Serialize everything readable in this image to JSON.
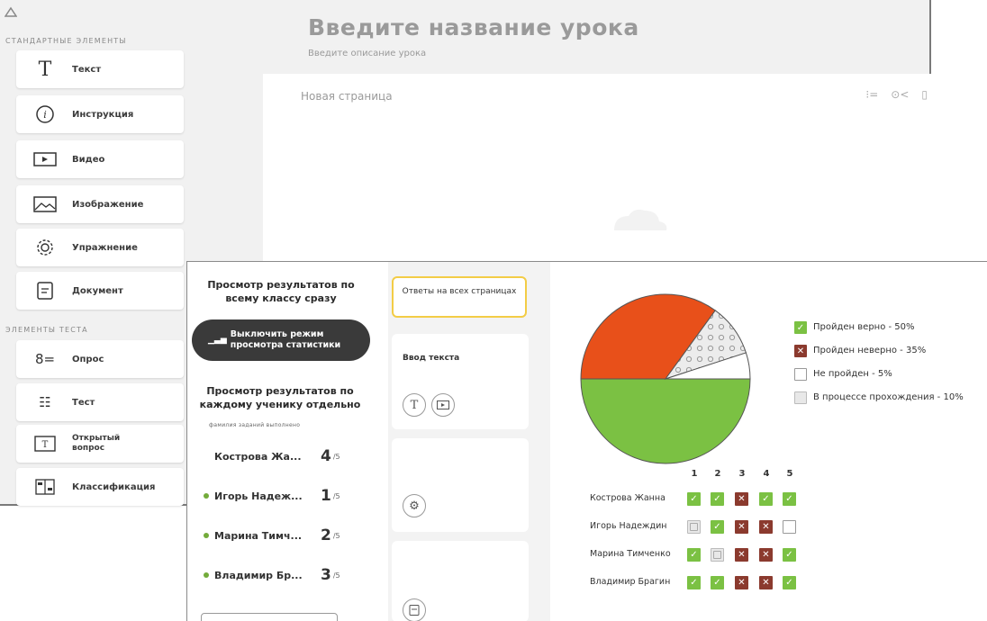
{
  "editor": {
    "sections": {
      "standard": "СТАНДАРТНЫЕ ЭЛЕМЕНТЫ",
      "test": "ЭЛЕМЕНТЫ ТЕСТА"
    },
    "standard_tools": [
      "Текст",
      "Инструкция",
      "Видео",
      "Изображение",
      "Упражнение",
      "Документ"
    ],
    "test_tools": [
      "Опрос",
      "Тест",
      "Открытый вопрос",
      "Классификация"
    ],
    "lesson_title": "Введите название урока",
    "lesson_description": "Введите описание урока",
    "page_name": "Новая страница"
  },
  "stats": {
    "class_view_heading": "Просмотр результатов по всему классу сразу",
    "toggle_label": "Выключить режим просмотра статистики",
    "student_view_heading": "Просмотр результатов по каждому ученику отдельно",
    "student_col_labels": "фамилия заданий выполнено",
    "students": [
      {
        "name": "Кострова Жа...",
        "score": "4",
        "total": "/5",
        "dot": false
      },
      {
        "name": "Игорь Надеж...",
        "score": "1",
        "total": "/5",
        "dot": true
      },
      {
        "name": "Марина Тимч...",
        "score": "2",
        "total": "/5",
        "dot": true
      },
      {
        "name": "Владимир Бр...",
        "score": "3",
        "total": "/5",
        "dot": true
      }
    ],
    "all_pages_button": "Ответы на всех страницах",
    "text_input_card": "Ввод текста"
  },
  "chart_data": {
    "type": "pie",
    "values": [
      50,
      35,
      5,
      10
    ],
    "legend": [
      "Пройден верно - 50%",
      "Пройден неверно - 35%",
      "Не пройден - 5%",
      "В процессе прохождения - 10%"
    ],
    "colors": [
      "#7bc143",
      "#e8501a",
      "#ffffff",
      "#e6e6e6"
    ],
    "legend_placement": "right"
  },
  "results_table": {
    "columns": [
      "1",
      "2",
      "3",
      "4",
      "5"
    ],
    "rows": [
      {
        "name": "Кострова Жанна",
        "cells": [
          "pass",
          "pass",
          "fail",
          "pass",
          "pass"
        ]
      },
      {
        "name": "Игорь Надеждин",
        "cells": [
          "prog",
          "pass",
          "fail",
          "fail",
          "none"
        ]
      },
      {
        "name": "Марина Тимченко",
        "cells": [
          "pass",
          "prog",
          "fail",
          "fail",
          "pass"
        ]
      },
      {
        "name": "Владимир Брагин",
        "cells": [
          "pass",
          "pass",
          "fail",
          "fail",
          "pass"
        ]
      }
    ]
  }
}
